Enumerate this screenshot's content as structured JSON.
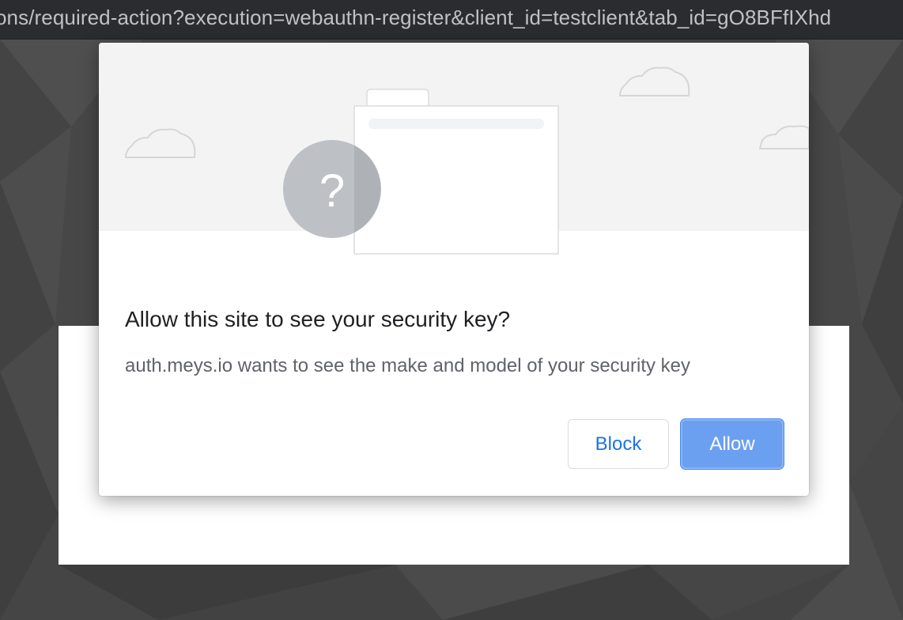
{
  "address_bar": {
    "url": "ons/required-action?execution=webauthn-register&client_id=testclient&tab_id=gO8BFfIXhd"
  },
  "dialog": {
    "title": "Allow this site to see your security key?",
    "message": "auth.meys.io wants to see the make and model of your security key",
    "illustration_glyph": "?",
    "buttons": {
      "block_label": "Block",
      "allow_label": "Allow"
    }
  },
  "colors": {
    "accent": "#1a73e8",
    "allow_button_bg": "#6b9ff0",
    "background": "#4a4a4a"
  },
  "icons": {
    "illustration": "security-key-question-icon"
  }
}
